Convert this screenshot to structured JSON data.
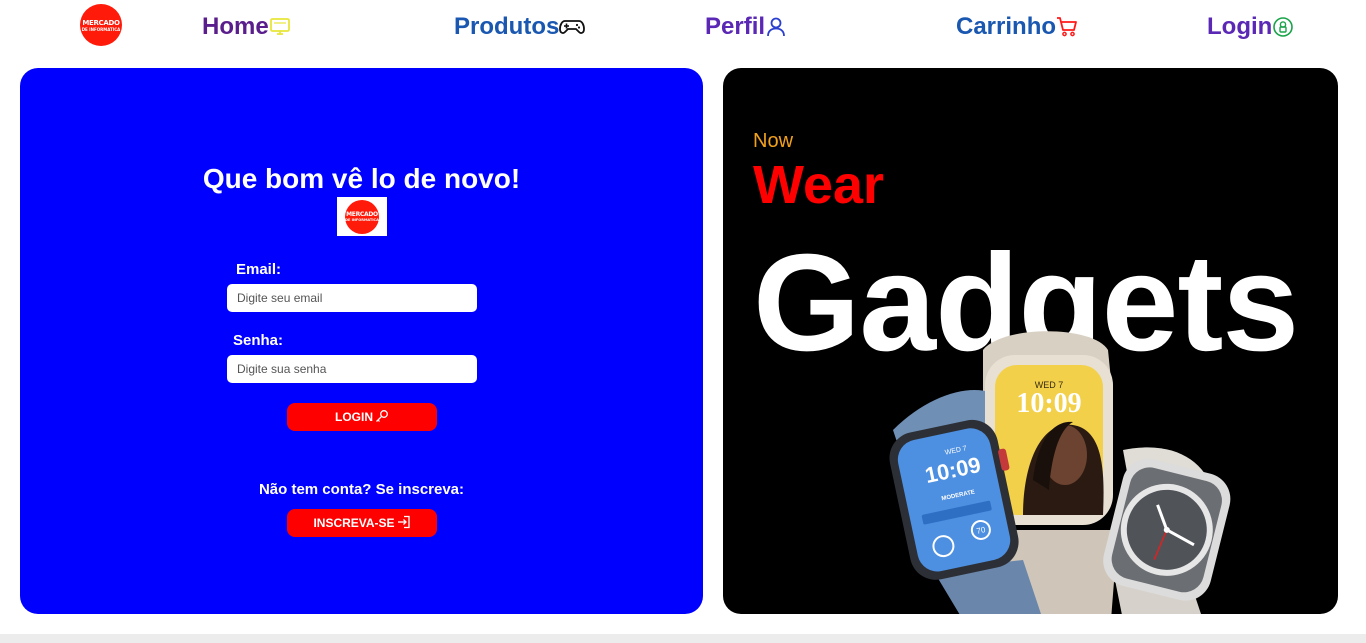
{
  "nav": {
    "logo": {
      "line1": "MERCADO",
      "line2": "DE INFORMATICA"
    },
    "items": [
      {
        "label": "Home",
        "icon": "monitor-icon",
        "color": "#5a1e8c",
        "icon_color": "#e8e63a"
      },
      {
        "label": "Produtos",
        "icon": "gamepad-icon",
        "color": "#1a57b0",
        "icon_color": "#111111"
      },
      {
        "label": "Perfil",
        "icon": "user-icon",
        "color": "#5a28b4",
        "icon_color": "#2a3fd0"
      },
      {
        "label": "Carrinho",
        "icon": "cart-icon",
        "color": "#1a57b0",
        "icon_color": "#ff1a1a"
      },
      {
        "label": "Login",
        "icon": "login-badge-icon",
        "color": "#5a28b4",
        "icon_color": "#1aa34a"
      }
    ]
  },
  "login": {
    "greeting": "Que bom vê lo de novo!",
    "email_label": "Email:",
    "email_placeholder": "Digite seu email",
    "senha_label": "Senha:",
    "senha_placeholder": "Digite sua senha",
    "login_button": "LOGIN",
    "signup_prompt": "Não tem conta? Se inscreva:",
    "signup_button": "INSCREVA-SE",
    "panel_color": "#0000ff",
    "button_color": "#ff0000"
  },
  "promo": {
    "now": "Now",
    "wear": "Wear",
    "gadgets": "Gadgets",
    "watch_front_date": "WED 7",
    "watch_front_time": "10:09",
    "watch_left_date": "WED 7",
    "watch_left_time": "10:09",
    "watch_left_status": "MODERATE",
    "watch_left_number": "70"
  }
}
